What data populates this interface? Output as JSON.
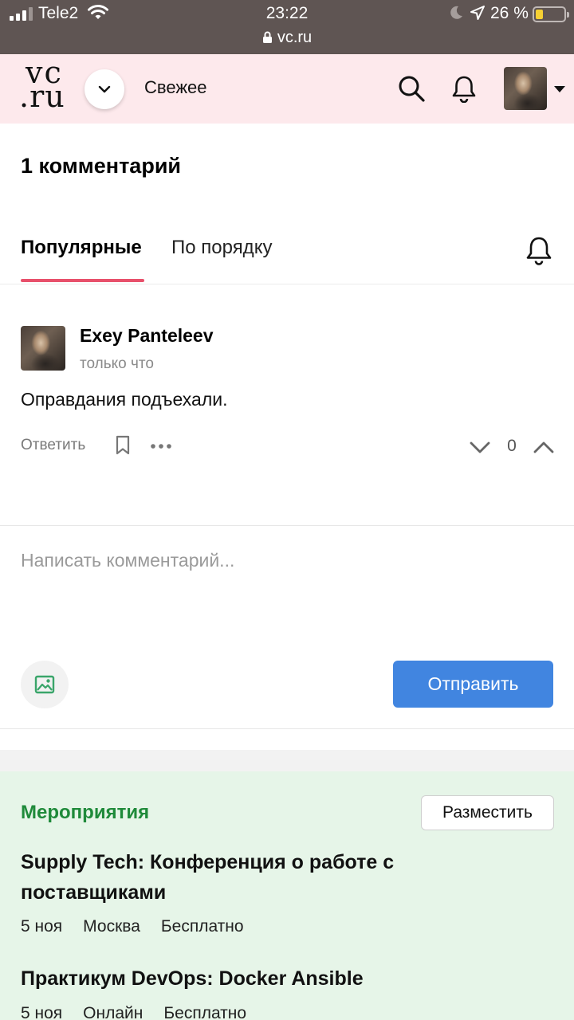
{
  "status_bar": {
    "carrier": "Tele2",
    "time": "23:22",
    "url": "vc.ru",
    "battery": "26 %"
  },
  "header": {
    "logo_top": "vc",
    "logo_bottom": ".ru",
    "section": "Свежее"
  },
  "comments": {
    "title": "1 комментарий",
    "tabs": [
      {
        "label": "Популярные",
        "active": true
      },
      {
        "label": "По порядку",
        "active": false
      }
    ],
    "items": [
      {
        "author": "Exey Panteleev",
        "time": "только что",
        "text": "Оправдания подъехали.",
        "reply_label": "Ответить",
        "votes": "0"
      }
    ]
  },
  "compose": {
    "placeholder": "Написать комментарий...",
    "submit_label": "Отправить"
  },
  "events": {
    "title": "Мероприятия",
    "place_label": "Разместить",
    "items": [
      {
        "title": "Supply Tech: Конференция о работе с поставщиками",
        "date": "5 ноя",
        "city": "Москва",
        "price": "Бесплатно"
      },
      {
        "title": "Практикум DevOps: Docker Ansible",
        "date": "5 ноя",
        "city": "Онлайн",
        "price": "Бесплатно"
      }
    ]
  },
  "colors": {
    "header_bg": "#fde9ec",
    "tab_accent": "#e8506b",
    "submit_button": "#4185e0",
    "events_bg": "#e6f5e8",
    "events_title": "#1f8a3a"
  },
  "icons": [
    "signal-icon",
    "wifi-icon",
    "lock-icon",
    "moon-icon",
    "location-icon",
    "battery-icon",
    "chevron-down-icon",
    "search-icon",
    "bell-icon",
    "bookmark-icon",
    "more-icon",
    "vote-down-icon",
    "vote-up-icon",
    "image-icon"
  ]
}
